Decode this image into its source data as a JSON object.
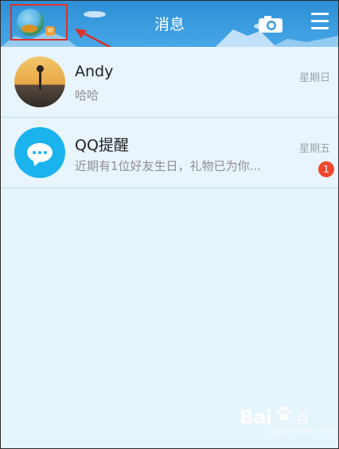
{
  "header": {
    "title": "消息",
    "avatar_status_badge": "≡",
    "bg_color": "#3a9be0"
  },
  "conversations": [
    {
      "name": "Andy",
      "preview": "哈哈",
      "time": "星期日",
      "avatar": "sunset-person-avatar"
    },
    {
      "name": "QQ提醒",
      "preview": "近期有1位好友生日，礼物已为你...",
      "time": "星期五",
      "unread": "1",
      "avatar": "chat-bubble-avatar"
    }
  ],
  "watermark": {
    "logo": "Bai",
    "logo2": "百",
    "sub": "jingyan.baidu.com"
  },
  "icons": {
    "camera": "camera-icon",
    "menu": "menu-icon",
    "bubble": "chat-bubble-icon"
  },
  "colors": {
    "annotation": "#d9322b",
    "badge": "#f0462d",
    "qq_blue": "#1ab3ee"
  }
}
